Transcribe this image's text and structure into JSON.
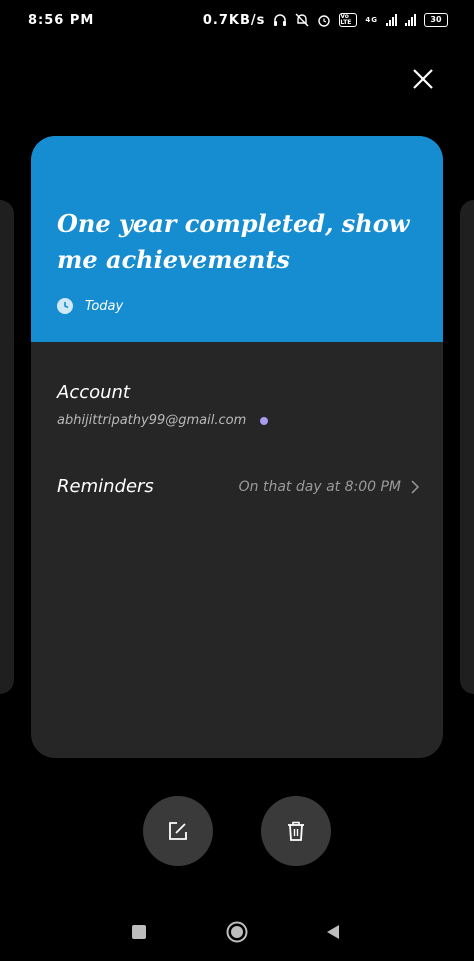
{
  "status_bar": {
    "time": "8:56 PM",
    "speed": "0.7KB/s",
    "battery": "30",
    "network": "4G",
    "volte": "Vo LTE"
  },
  "card": {
    "title": "One year completed, show me achievements",
    "date": "Today",
    "header_color": "#168dd0",
    "account_label": "Account",
    "account_email": "abhijittripathy99@gmail.com",
    "account_dot_color": "#a79cf0",
    "reminders_label": "Reminders",
    "reminders_value": "On that day at 8:00 PM"
  },
  "icons": {
    "close": "close-icon",
    "clock": "clock-icon",
    "chevron": "chevron-right-icon",
    "edit": "edit-icon",
    "delete": "trash-icon",
    "nav_recents": "square-icon",
    "nav_home": "home-circle-icon",
    "nav_back": "back-triangle-icon"
  }
}
